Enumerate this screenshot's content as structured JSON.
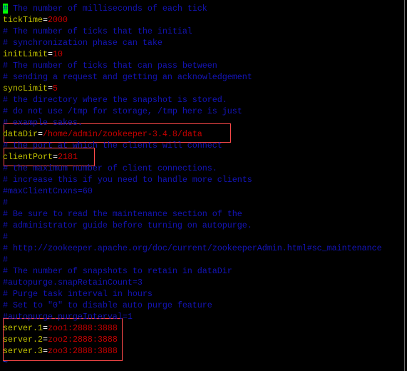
{
  "colors": {
    "comment": "#1414b8",
    "key": "#c0c000",
    "equals": "#ffffff",
    "value": "#c80000",
    "cursor": "#00ff00",
    "highlight_box": "#ff4a4a",
    "tilde": "#4040ff"
  },
  "lines": [
    {
      "comment": "# The number of milliseconds of each tick",
      "cursor": true
    },
    {
      "key": "tickTime",
      "value": "2000"
    },
    {
      "comment": "# The number of ticks that the initial"
    },
    {
      "comment": "# synchronization phase can take"
    },
    {
      "key": "initLimit",
      "value": "10"
    },
    {
      "comment": "# The number of ticks that can pass between"
    },
    {
      "comment": "# sending a request and getting an acknowledgement"
    },
    {
      "key": "syncLimit",
      "value": "5"
    },
    {
      "comment": "# the directory where the snapshot is stored."
    },
    {
      "comment": "# do not use /tmp for storage, /tmp here is just"
    },
    {
      "comment": "# example sakes."
    },
    {
      "key": "dataDir",
      "value": "/home/admin/zookeeper-3.4.8/data"
    },
    {
      "comment": "# the port at which the clients will connect"
    },
    {
      "key": "clientPort",
      "value": "2181"
    },
    {
      "comment": "# the maximum number of client connections."
    },
    {
      "comment": "# increase this if you need to handle more clients"
    },
    {
      "comment": "#maxClientCnxns=60"
    },
    {
      "comment": "#"
    },
    {
      "comment": "# Be sure to read the maintenance section of the"
    },
    {
      "comment": "# administrator guide before turning on autopurge."
    },
    {
      "comment": "#"
    },
    {
      "comment": "# http://zookeeper.apache.org/doc/current/zookeeperAdmin.html#sc_maintenance"
    },
    {
      "comment": "#"
    },
    {
      "comment": "# The number of snapshots to retain in dataDir"
    },
    {
      "comment": "#autopurge.snapRetainCount=3"
    },
    {
      "comment": "# Purge task interval in hours"
    },
    {
      "comment": "# Set to \"0\" to disable auto purge feature"
    },
    {
      "comment": "#autopurge.purgeInterval=1"
    },
    {
      "key": "server.1",
      "value": "zoo1:2888:3888"
    },
    {
      "key": "server.2",
      "value": "zoo2:2888:3888"
    },
    {
      "key": "server.3",
      "value": "zoo3:2888:3888"
    },
    {
      "tilde": "~"
    }
  ],
  "highlight_boxes": [
    {
      "label": "dataDir"
    },
    {
      "label": "clientPort"
    },
    {
      "label": "servers"
    }
  ]
}
